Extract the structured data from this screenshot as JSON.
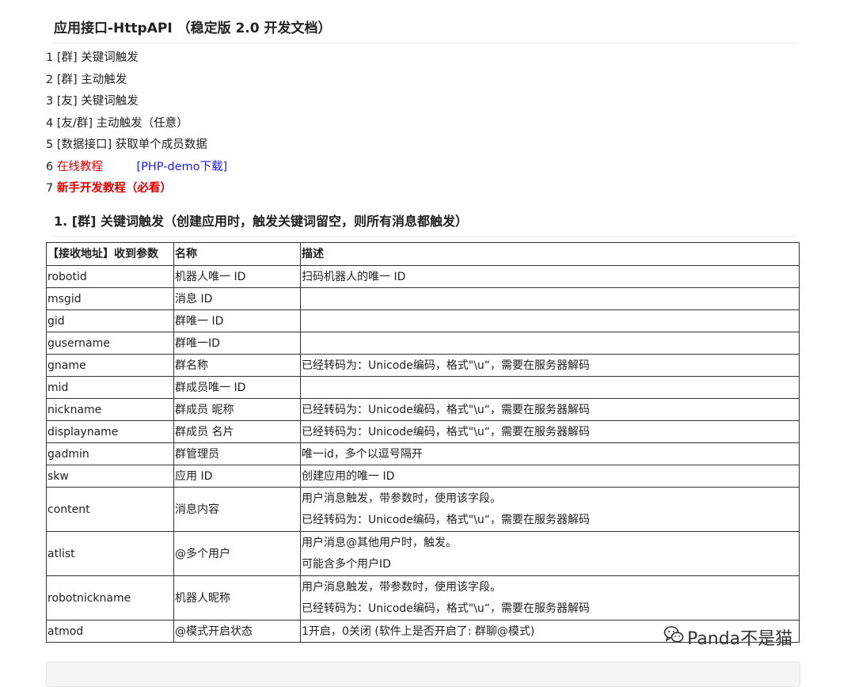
{
  "title": "应用接口-HttpAPI （稳定版 2.0 开发文档）",
  "toc": [
    {
      "num": "1",
      "text": "[群] 关键词触发"
    },
    {
      "num": "2",
      "text": "[群] 主动触发"
    },
    {
      "num": "3",
      "text": "[友] 关键词触发"
    },
    {
      "num": "4",
      "text": "[友/群] 主动触发（任意）"
    },
    {
      "num": "5",
      "text": "[数据接口] 获取单个成员数据"
    },
    {
      "num": "6",
      "text": "在线教程",
      "extra": "[PHP-demo下载]"
    },
    {
      "num": "7",
      "text": "新手开发教程（必看）"
    }
  ],
  "section_title": "1. [群] 关键词触发（创建应用时，触发关键词留空，则所有消息都触发）",
  "table": {
    "headers": [
      "【接收地址】收到参数",
      "名称",
      "描述"
    ],
    "rows": [
      {
        "param": "robotid",
        "name": "机器人唯一 ID",
        "desc": [
          "扫码机器人的唯一 ID"
        ]
      },
      {
        "param": "msgid",
        "name": "消息 ID",
        "desc": [
          ""
        ]
      },
      {
        "param": "gid",
        "name": "群唯一 ID",
        "desc": [
          ""
        ]
      },
      {
        "param": "gusername",
        "name": "群唯一ID",
        "desc": [
          ""
        ]
      },
      {
        "param": "gname",
        "name": "群名称",
        "desc": [
          "已经转码为：Unicode编码，格式\"\\u“，需要在服务器解码"
        ]
      },
      {
        "param": "mid",
        "name": "群成员唯一 ID",
        "desc": [
          ""
        ]
      },
      {
        "param": "nickname",
        "name": "群成员 昵称",
        "desc": [
          "已经转码为：Unicode编码，格式\"\\u“，需要在服务器解码"
        ]
      },
      {
        "param": "displayname",
        "name": "群成员 名片",
        "desc": [
          "已经转码为：Unicode编码，格式\"\\u“，需要在服务器解码"
        ]
      },
      {
        "param": "gadmin",
        "name": "群管理员",
        "desc": [
          "唯一id，多个以逗号隔开"
        ]
      },
      {
        "param": "skw",
        "name": "应用 ID",
        "desc": [
          "创建应用的唯一 ID"
        ]
      },
      {
        "param": "content",
        "name": "消息内容",
        "desc": [
          "用户消息触发，带参数时，使用该字段。",
          "已经转码为：Unicode编码，格式\"\\u“，需要在服务器解码"
        ]
      },
      {
        "param": "atlist",
        "name": "@多个用户",
        "desc": [
          "用户消息@其他用户时，触发。",
          "可能含多个用户ID"
        ]
      },
      {
        "param": "robotnickname",
        "name": "机器人昵称",
        "desc": [
          "用户消息触发，带参数时，使用该字段。",
          "已经转码为：Unicode编码，格式\"\\u“，需要在服务器解码"
        ]
      },
      {
        "param": "atmod",
        "name": "@模式开启状态",
        "desc": [
          "1开启，0关闭 (软件上是否开启了: 群聊@模式)"
        ]
      }
    ]
  },
  "watermark": {
    "text": "Panda不是猫",
    "icon": "wechat-icon"
  },
  "colors": {
    "red": "#e40000",
    "blue": "#1a1aff",
    "border": "#333333"
  }
}
